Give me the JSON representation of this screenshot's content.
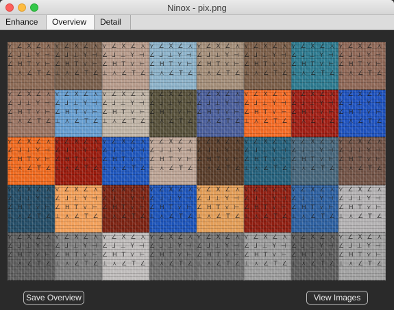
{
  "window": {
    "title": "Ninox - pix.png"
  },
  "tabs": [
    {
      "label": "Enhance",
      "active": false
    },
    {
      "label": "Overview",
      "active": true
    },
    {
      "label": "Detail",
      "active": false
    }
  ],
  "buttons": {
    "save_overview": "Save Overview",
    "view_images": "View Images"
  },
  "thumbnails": [
    {
      "color": "#8c6a55"
    },
    {
      "color": "#7a604d"
    },
    {
      "color": "#b79b8b"
    },
    {
      "color": "#8cb2c9"
    },
    {
      "color": "#a48e79"
    },
    {
      "color": "#7c5f49"
    },
    {
      "color": "#2d7a8f"
    },
    {
      "color": "#8f6857"
    },
    {
      "color": "#9b7563"
    },
    {
      "color": "#679ed0"
    },
    {
      "color": "#c0b4a6"
    },
    {
      "color": "#57513b"
    },
    {
      "color": "#4a5e9a"
    },
    {
      "color": "#f46b25"
    },
    {
      "color": "#9f1e14"
    },
    {
      "color": "#1e52be"
    },
    {
      "color": "#ef6a1f"
    },
    {
      "color": "#9a1b0d"
    },
    {
      "color": "#1e56bd"
    },
    {
      "color": "#bda596"
    },
    {
      "color": "#5a3e2b"
    },
    {
      "color": "#25617c"
    },
    {
      "color": "#47667b"
    },
    {
      "color": "#735447"
    },
    {
      "color": "#244d67"
    },
    {
      "color": "#f2a05a"
    },
    {
      "color": "#7c2313"
    },
    {
      "color": "#1d54b9"
    },
    {
      "color": "#e39e58"
    },
    {
      "color": "#8f1e11"
    },
    {
      "color": "#2d60a0"
    },
    {
      "color": "#b4b2b3"
    },
    {
      "color": "#5d5d5d"
    },
    {
      "color": "#7f7f7f"
    },
    {
      "color": "#bfbcbb"
    },
    {
      "color": "#6e6e6e"
    },
    {
      "color": "#727272"
    },
    {
      "color": "#9d9d9d"
    },
    {
      "color": "#5c5c5c"
    },
    {
      "color": "#a2a2a2"
    }
  ]
}
